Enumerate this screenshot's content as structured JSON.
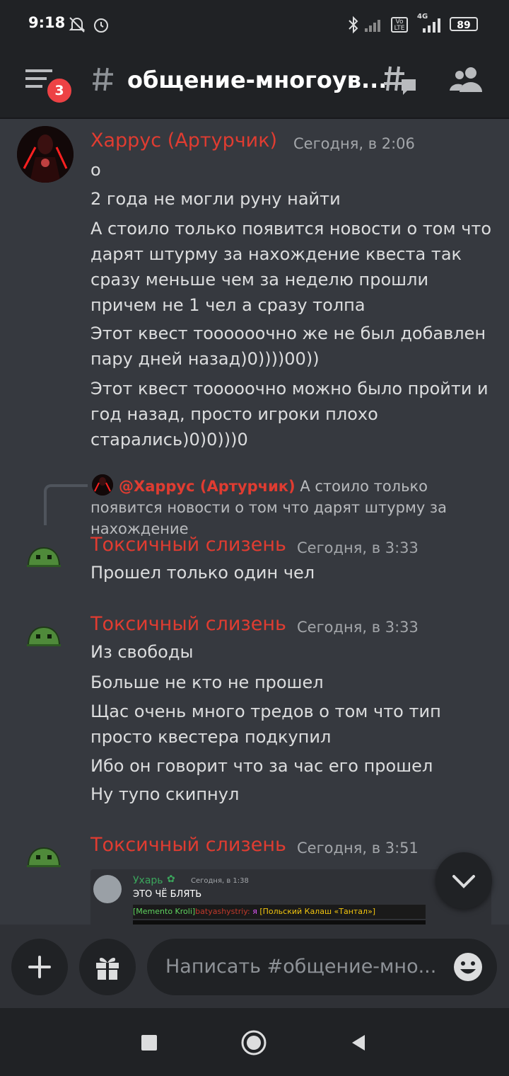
{
  "status_bar": {
    "time": "9:18",
    "battery": "89",
    "network": "4G",
    "icons": [
      "mute-bell-icon",
      "alarm-icon",
      "bluetooth-icon",
      "signal-icon",
      "volte-icon",
      "battery-icon"
    ]
  },
  "header": {
    "channel_name": "общение-многоув...",
    "unread_badge": "3",
    "icons": [
      "hamburger-icon",
      "hash-icon",
      "threads-icon",
      "members-icon"
    ]
  },
  "messages": [
    {
      "author": "Харрус (Артурчик)",
      "timestamp": "Сегодня, в 2:06",
      "lines": [
        "о",
        "2 года не могли руну найти",
        "А стоило только появится новости о том что дарят штурму за нахождение квеста так сразу меньше чем за неделю прошли причем не 1 чел а сразу толпа",
        "Этот квест тоооооочно же не был добавлен пару дней назад)0))))00))",
        "Этот квест тооооочно можно было пройти и год назад, просто игроки плохо старались)0)0)))0"
      ]
    },
    {
      "reply": {
        "author": "@Харрус (Артурчик)",
        "text": "А стоило только появится новости о том что дарят штурму за нахождение"
      },
      "author": "Токсичный слизень",
      "timestamp": "Сегодня, в 3:33",
      "lines": [
        "Прошел только один чел"
      ]
    },
    {
      "author": "Токсичный слизень",
      "timestamp": "Сегодня, в 3:33",
      "lines": [
        "Из свободы",
        "Больше не кто не прошел",
        "Щас очень много тредов о том что тип просто квестера подкупил",
        "Ибо он говорит что за час его прошел",
        "Ну тупо скипнул"
      ]
    },
    {
      "author": "Токсичный слизень",
      "timestamp": "Сегодня, в 3:51",
      "embed": {
        "author": "Ухарь",
        "timestamp": "Сегодня, в 1:38",
        "text": "ЭТО ЧЁ БЛЯТЬ",
        "line1_a": "[Memento Kroli]",
        "line1_b": "batyashystriy:",
        "line1_c": " я ",
        "line1_d": "[Польский Калаш «Тантал»]"
      }
    }
  ],
  "composer": {
    "placeholder": "Написать #общение-мно...",
    "icons": [
      "plus-icon",
      "gift-icon",
      "emoji-icon"
    ]
  },
  "nav": {
    "icons": [
      "recents-icon",
      "home-icon",
      "back-icon"
    ]
  },
  "colors": {
    "background": "#36393f",
    "header": "#202225",
    "author_red": "#e03c31",
    "badge_red": "#ed4245"
  }
}
